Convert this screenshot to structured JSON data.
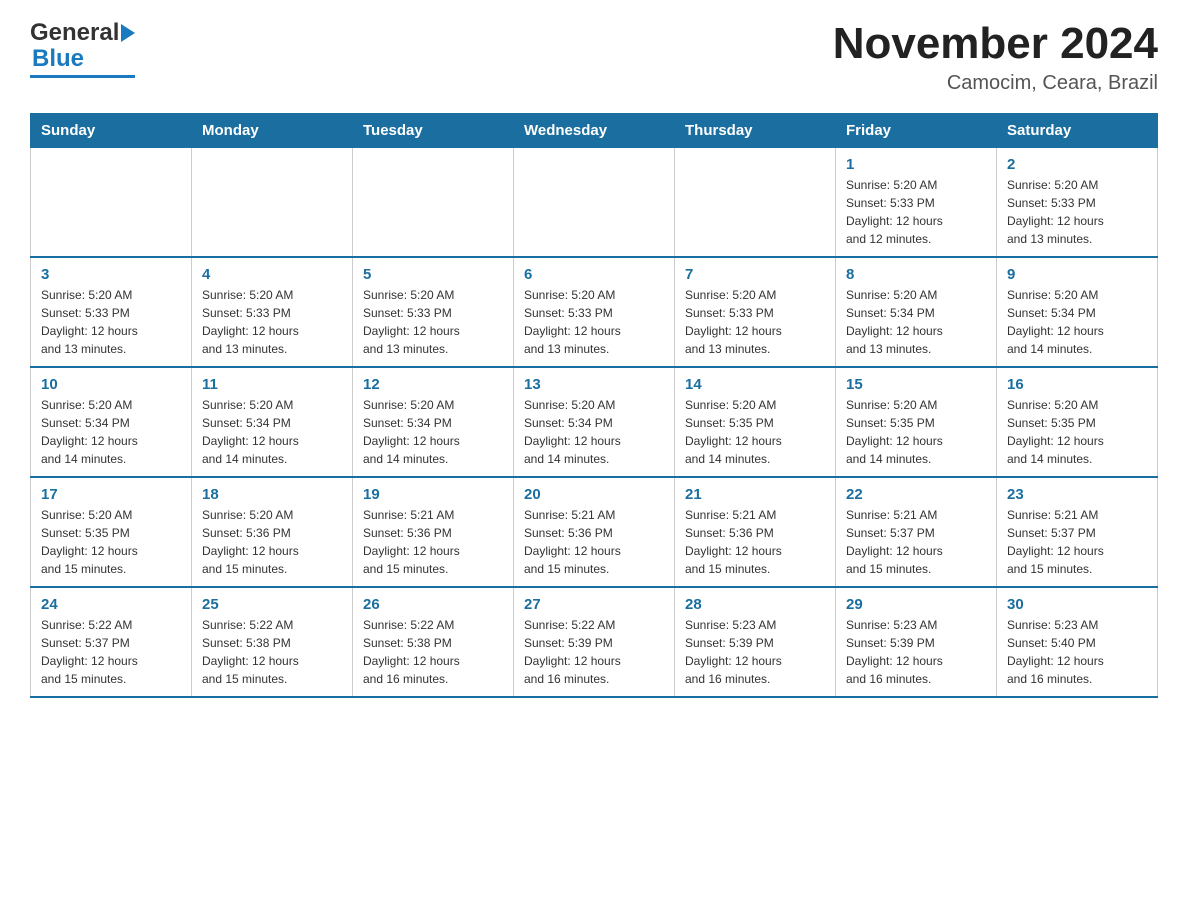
{
  "header": {
    "logo_general": "General",
    "logo_blue": "Blue",
    "title": "November 2024",
    "subtitle": "Camocim, Ceara, Brazil"
  },
  "weekdays": [
    "Sunday",
    "Monday",
    "Tuesday",
    "Wednesday",
    "Thursday",
    "Friday",
    "Saturday"
  ],
  "rows": [
    {
      "cells": [
        {
          "day": "",
          "info": ""
        },
        {
          "day": "",
          "info": ""
        },
        {
          "day": "",
          "info": ""
        },
        {
          "day": "",
          "info": ""
        },
        {
          "day": "",
          "info": ""
        },
        {
          "day": "1",
          "info": "Sunrise: 5:20 AM\nSunset: 5:33 PM\nDaylight: 12 hours\nand 12 minutes."
        },
        {
          "day": "2",
          "info": "Sunrise: 5:20 AM\nSunset: 5:33 PM\nDaylight: 12 hours\nand 13 minutes."
        }
      ]
    },
    {
      "cells": [
        {
          "day": "3",
          "info": "Sunrise: 5:20 AM\nSunset: 5:33 PM\nDaylight: 12 hours\nand 13 minutes."
        },
        {
          "day": "4",
          "info": "Sunrise: 5:20 AM\nSunset: 5:33 PM\nDaylight: 12 hours\nand 13 minutes."
        },
        {
          "day": "5",
          "info": "Sunrise: 5:20 AM\nSunset: 5:33 PM\nDaylight: 12 hours\nand 13 minutes."
        },
        {
          "day": "6",
          "info": "Sunrise: 5:20 AM\nSunset: 5:33 PM\nDaylight: 12 hours\nand 13 minutes."
        },
        {
          "day": "7",
          "info": "Sunrise: 5:20 AM\nSunset: 5:33 PM\nDaylight: 12 hours\nand 13 minutes."
        },
        {
          "day": "8",
          "info": "Sunrise: 5:20 AM\nSunset: 5:34 PM\nDaylight: 12 hours\nand 13 minutes."
        },
        {
          "day": "9",
          "info": "Sunrise: 5:20 AM\nSunset: 5:34 PM\nDaylight: 12 hours\nand 14 minutes."
        }
      ]
    },
    {
      "cells": [
        {
          "day": "10",
          "info": "Sunrise: 5:20 AM\nSunset: 5:34 PM\nDaylight: 12 hours\nand 14 minutes."
        },
        {
          "day": "11",
          "info": "Sunrise: 5:20 AM\nSunset: 5:34 PM\nDaylight: 12 hours\nand 14 minutes."
        },
        {
          "day": "12",
          "info": "Sunrise: 5:20 AM\nSunset: 5:34 PM\nDaylight: 12 hours\nand 14 minutes."
        },
        {
          "day": "13",
          "info": "Sunrise: 5:20 AM\nSunset: 5:34 PM\nDaylight: 12 hours\nand 14 minutes."
        },
        {
          "day": "14",
          "info": "Sunrise: 5:20 AM\nSunset: 5:35 PM\nDaylight: 12 hours\nand 14 minutes."
        },
        {
          "day": "15",
          "info": "Sunrise: 5:20 AM\nSunset: 5:35 PM\nDaylight: 12 hours\nand 14 minutes."
        },
        {
          "day": "16",
          "info": "Sunrise: 5:20 AM\nSunset: 5:35 PM\nDaylight: 12 hours\nand 14 minutes."
        }
      ]
    },
    {
      "cells": [
        {
          "day": "17",
          "info": "Sunrise: 5:20 AM\nSunset: 5:35 PM\nDaylight: 12 hours\nand 15 minutes."
        },
        {
          "day": "18",
          "info": "Sunrise: 5:20 AM\nSunset: 5:36 PM\nDaylight: 12 hours\nand 15 minutes."
        },
        {
          "day": "19",
          "info": "Sunrise: 5:21 AM\nSunset: 5:36 PM\nDaylight: 12 hours\nand 15 minutes."
        },
        {
          "day": "20",
          "info": "Sunrise: 5:21 AM\nSunset: 5:36 PM\nDaylight: 12 hours\nand 15 minutes."
        },
        {
          "day": "21",
          "info": "Sunrise: 5:21 AM\nSunset: 5:36 PM\nDaylight: 12 hours\nand 15 minutes."
        },
        {
          "day": "22",
          "info": "Sunrise: 5:21 AM\nSunset: 5:37 PM\nDaylight: 12 hours\nand 15 minutes."
        },
        {
          "day": "23",
          "info": "Sunrise: 5:21 AM\nSunset: 5:37 PM\nDaylight: 12 hours\nand 15 minutes."
        }
      ]
    },
    {
      "cells": [
        {
          "day": "24",
          "info": "Sunrise: 5:22 AM\nSunset: 5:37 PM\nDaylight: 12 hours\nand 15 minutes."
        },
        {
          "day": "25",
          "info": "Sunrise: 5:22 AM\nSunset: 5:38 PM\nDaylight: 12 hours\nand 15 minutes."
        },
        {
          "day": "26",
          "info": "Sunrise: 5:22 AM\nSunset: 5:38 PM\nDaylight: 12 hours\nand 16 minutes."
        },
        {
          "day": "27",
          "info": "Sunrise: 5:22 AM\nSunset: 5:39 PM\nDaylight: 12 hours\nand 16 minutes."
        },
        {
          "day": "28",
          "info": "Sunrise: 5:23 AM\nSunset: 5:39 PM\nDaylight: 12 hours\nand 16 minutes."
        },
        {
          "day": "29",
          "info": "Sunrise: 5:23 AM\nSunset: 5:39 PM\nDaylight: 12 hours\nand 16 minutes."
        },
        {
          "day": "30",
          "info": "Sunrise: 5:23 AM\nSunset: 5:40 PM\nDaylight: 12 hours\nand 16 minutes."
        }
      ]
    }
  ]
}
